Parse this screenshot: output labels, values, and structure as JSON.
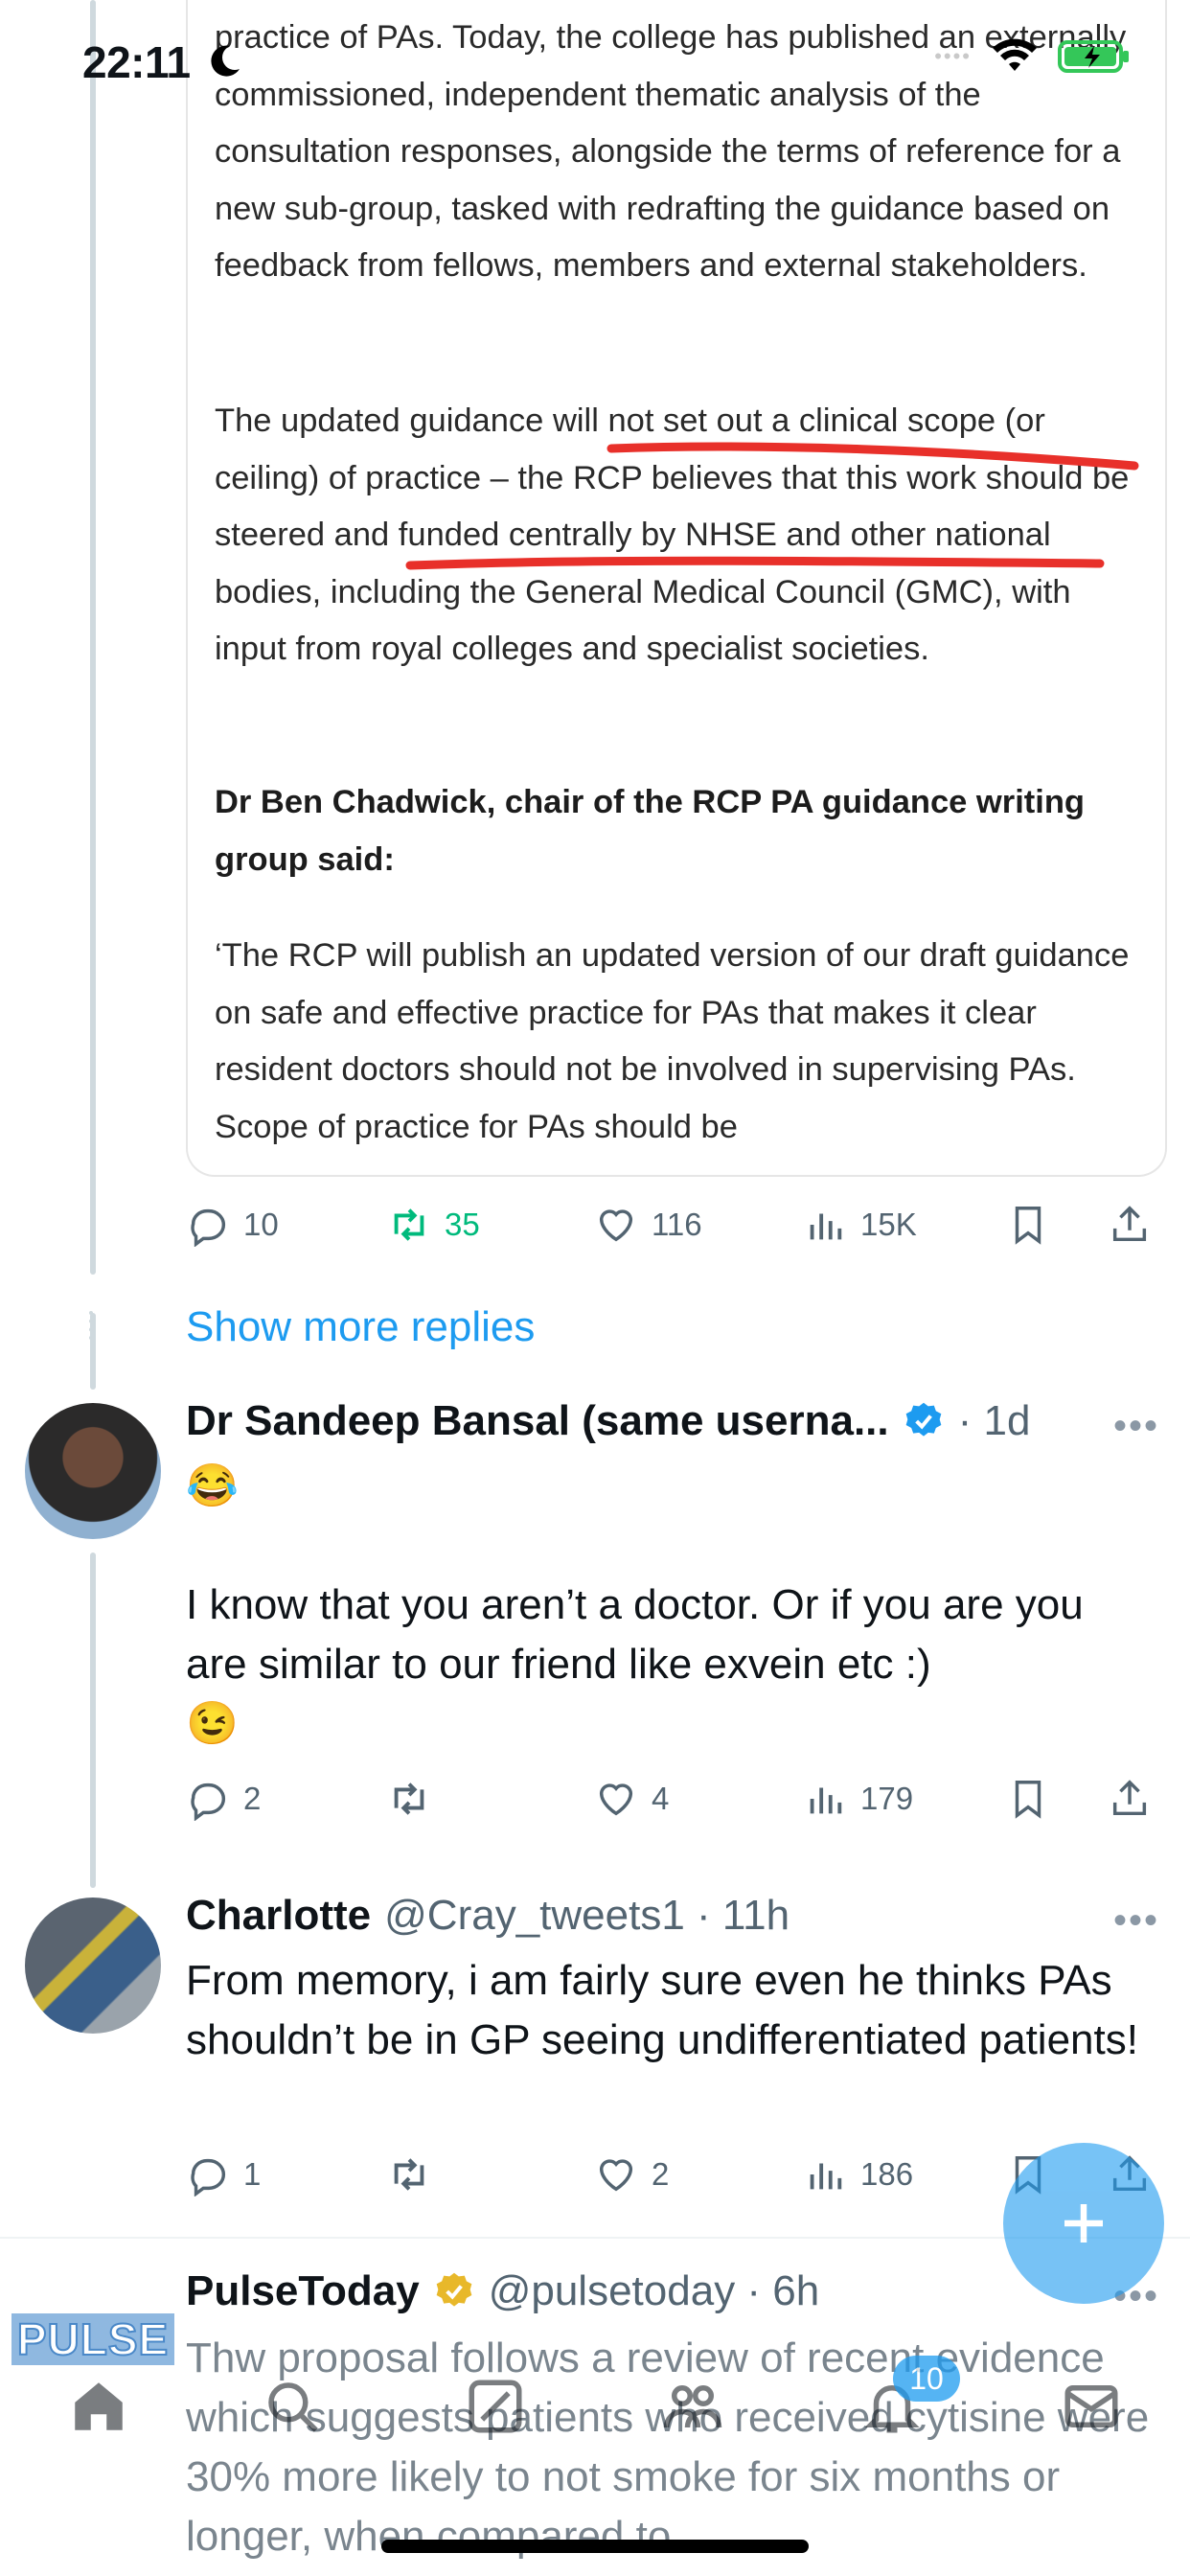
{
  "status_bar": {
    "time": "22:11",
    "battery_color": "#34c759"
  },
  "embedded_image": {
    "paragraph_1": "practice of PAs. Today, the college has published an externally commissioned, independent thematic analysis of the consultation responses, alongside the terms of reference for a new sub-group, tasked with redrafting the guidance based on feedback from fellows, members and external stakeholders.",
    "paragraph_2": "The updated guidance will not set out a clinical scope (or ceiling) of practice – the RCP believes that this work should be steered and funded centrally by NHSE and other national bodies, including the General Medical Council (GMC), with input from royal colleges and specialist societies.",
    "paragraph_3": "Dr Ben Chadwick, chair of the RCP PA guidance writing group said:",
    "paragraph_4": "‘The RCP will publish an updated version of our draft guidance on safe and effective practice for PAs that makes it clear resident doctors should not be involved in supervising PAs. Scope of practice for PAs should be",
    "annotation_color": "#e8302a"
  },
  "first_tweet_actions": {
    "replies": "10",
    "reposts": "35",
    "likes": "116",
    "views": "15K"
  },
  "show_more_replies": "Show more replies",
  "tweets": [
    {
      "name": "Dr Sandeep Bansal (same userna...",
      "verified": "blue",
      "time": "· 1d",
      "line1": "😂",
      "line2": "I know that you aren’t a doctor. Or if you are you are similar to our friend like exvein etc :)",
      "line3": "😉",
      "replies": "2",
      "reposts": "",
      "likes": "4",
      "views": "179"
    },
    {
      "name": "Charlotte",
      "handle": "@Cray_tweets1 · 11h",
      "text": "From memory, i am fairly sure even he thinks PAs shouldn’t be in GP seeing undifferentiated patients!",
      "replies": "1",
      "reposts": "",
      "likes": "2",
      "views": "186"
    },
    {
      "name": "PulseToday",
      "verified": "gold",
      "handle": "@pulsetoday · 6h",
      "avatar_label": "PULSE",
      "text": "Thw proposal follows a review of recent evidence which suggests patients who received cytisine were 30% more likely to not smoke for six months or longer, when compared to"
    }
  ],
  "bottom_nav": {
    "notifications_badge": "10"
  },
  "accent_color": "#1d9bf0"
}
